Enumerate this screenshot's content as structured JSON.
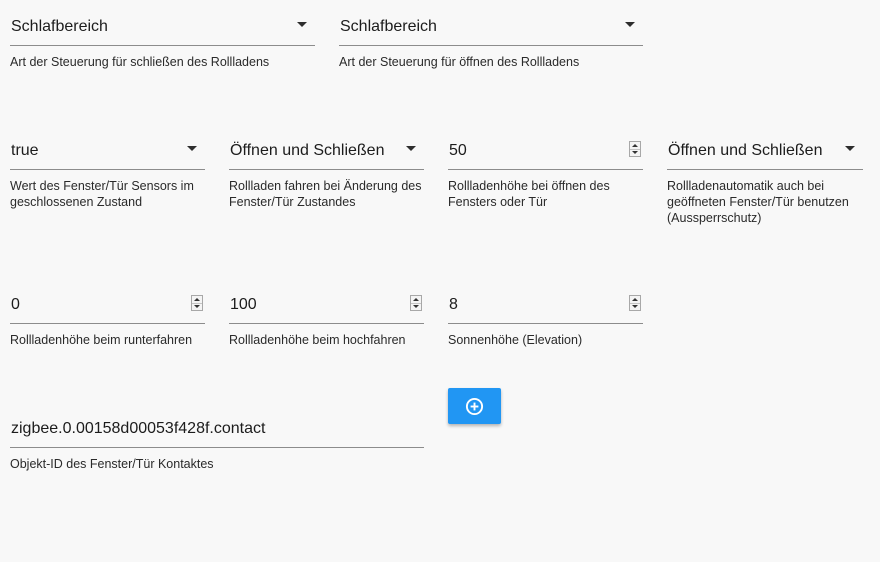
{
  "row1": [
    {
      "value": "Schlafbereich",
      "label": "Art der Steuerung für schließen des Rollladens"
    },
    {
      "value": "Schlafbereich",
      "label": "Art der Steuerung für öffnen des Rollladens"
    }
  ],
  "row2": [
    {
      "value": "true",
      "label": "Wert des Fenster/Tür Sensors im geschlossenen Zustand"
    },
    {
      "value": "Öffnen und Schließen",
      "label": "Rollladen fahren bei Änderung des Fenster/Tür Zustandes"
    },
    {
      "value": "50",
      "label": "Rollladenhöhe bei öffnen des Fensters oder Tür"
    },
    {
      "value": "Öffnen und Schließen",
      "label": "Rollladenautomatik auch bei geöffneten Fenster/Tür benutzen (Aussperrschutz)"
    }
  ],
  "row3": [
    {
      "value": "0",
      "label": "Rollladenhöhe beim runterfahren"
    },
    {
      "value": "100",
      "label": "Rollladenhöhe beim hochfahren"
    },
    {
      "value": "8",
      "label": "Sonnenhöhe (Elevation)"
    }
  ],
  "object_id": {
    "value": "zigbee.0.00158d00053f428f.contact",
    "label": "Objekt-ID des Fenster/Tür Kontaktes"
  },
  "add_button": {
    "icon": "plus-circle-icon"
  },
  "colors": {
    "background": "#f8f8f8",
    "accent": "#2196f3",
    "underline": "#8c8c8c"
  }
}
